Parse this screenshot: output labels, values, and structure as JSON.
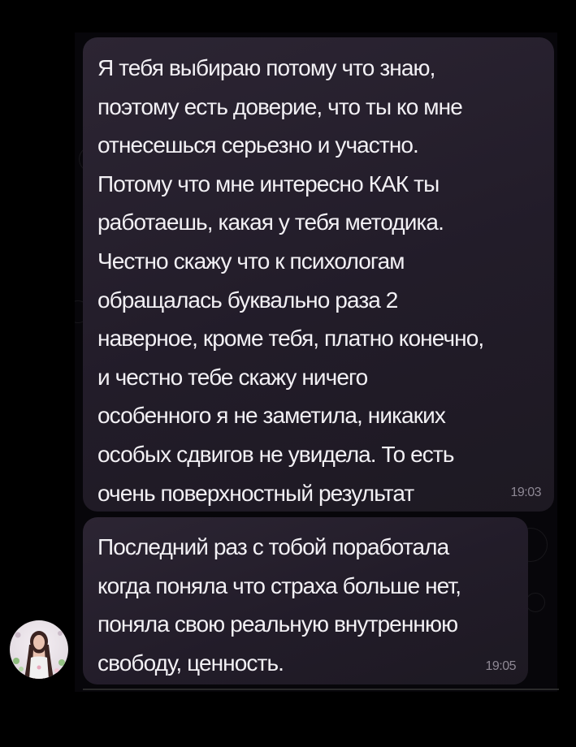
{
  "messages": [
    {
      "text": "Я тебя выбираю потому что знаю,\nпоэтому есть доверие, что ты ко мне\nотнесешься серьезно и участно.\nПотому что мне интересно КАК ты\nработаешь, какая у тебя методика.\nЧестно скажу что к психологам\nобращалась буквально раза 2\nнаверное, кроме тебя, платно конечно,\nи честно тебе скажу ничего\nособенного я не заметила, никаких\nособых сдвигов не увидела. То есть\nочень поверхностный результат",
      "time": "19:03"
    },
    {
      "text": "Последний раз с тобой поработала\nкогда поняла что страха больше нет,\nпоняла свою реальную внутреннюю\nсвободу, ценность.",
      "time": "19:05"
    }
  ],
  "colors": {
    "background": "#000000",
    "bubble": "#241e2b",
    "text": "#f2f0f4",
    "time": "#8e8894"
  },
  "icons": {
    "avatar": "user-avatar-photo"
  }
}
